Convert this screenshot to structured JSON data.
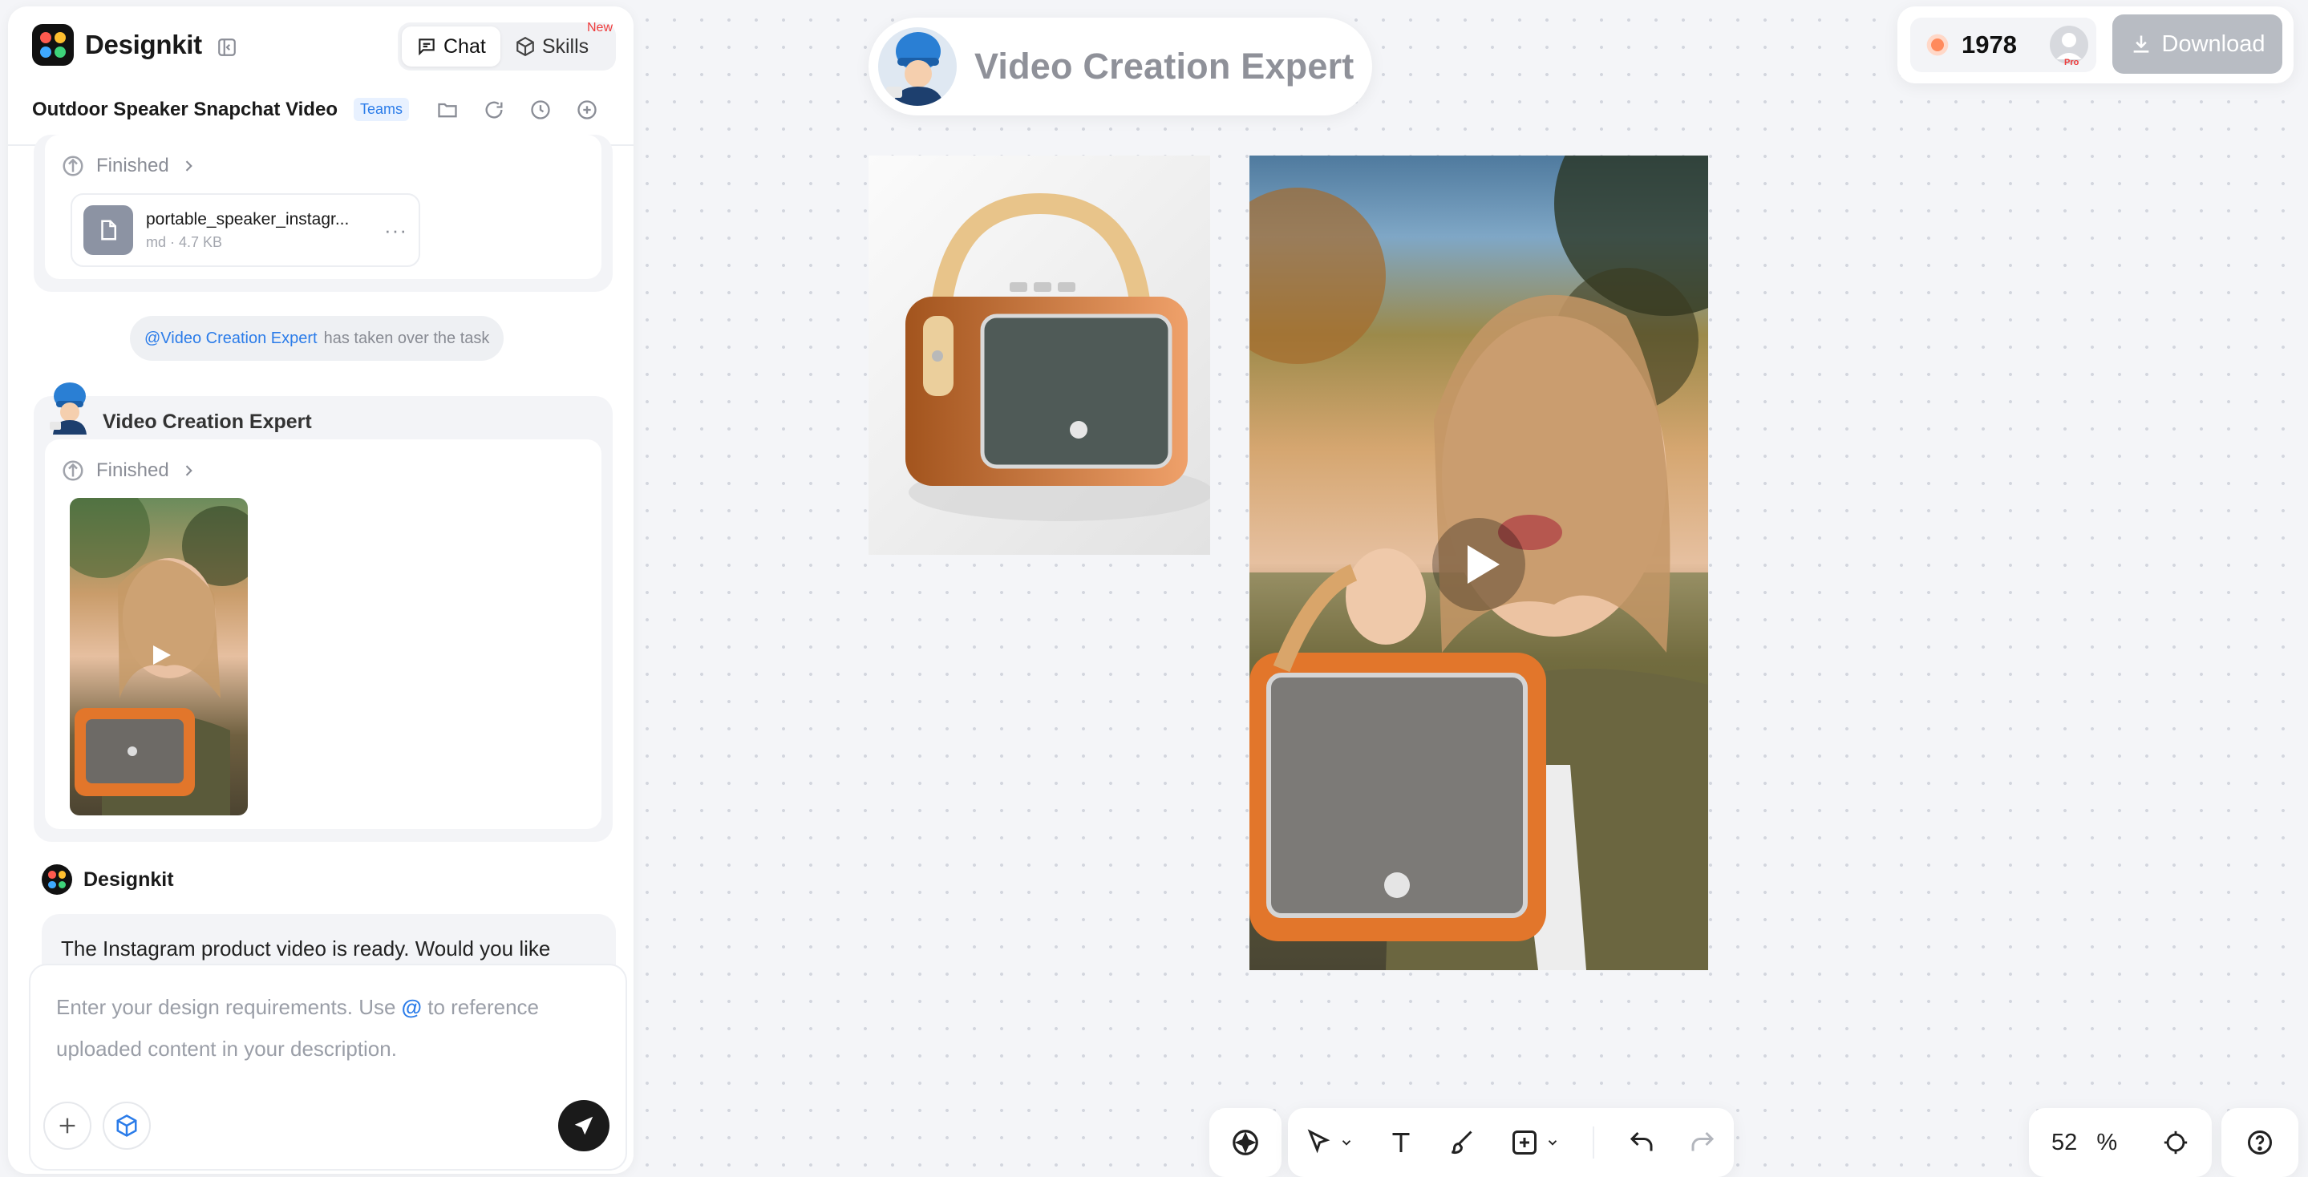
{
  "app": {
    "brand": "Designkit",
    "modes": [
      {
        "label": "Chat",
        "active": true
      },
      {
        "label": "Skills",
        "badge": "New"
      }
    ]
  },
  "project": {
    "title": "Outdoor Speaker Snapchat Video",
    "badge": "Teams"
  },
  "chat": {
    "prev_step_status": "Finished",
    "file": {
      "name": "portable_speaker_instagr...",
      "meta": "md · 4.7 KB"
    },
    "takeover": {
      "mention": "@Video Creation Expert",
      "text": "has taken over the task"
    },
    "agent": {
      "name": "Video Creation Expert",
      "status": "Finished"
    },
    "designkit_label": "Designkit",
    "reply": "The Instagram product video is ready. Would you like"
  },
  "composer": {
    "placeholder_before": "Enter your design requirements. Use ",
    "placeholder_at": "@",
    "placeholder_after": " to reference uploaded content in your description."
  },
  "canvas": {
    "agent_title": "Video Creation Expert"
  },
  "account": {
    "credits": "1978",
    "plan": "Pro",
    "download_label": "Download"
  },
  "zoom": {
    "value": "52",
    "unit": "%"
  },
  "colors": {
    "accent": "#2b7ce9",
    "badge_red": "#ef3b3b",
    "speaker_orange": "#e8782a"
  }
}
